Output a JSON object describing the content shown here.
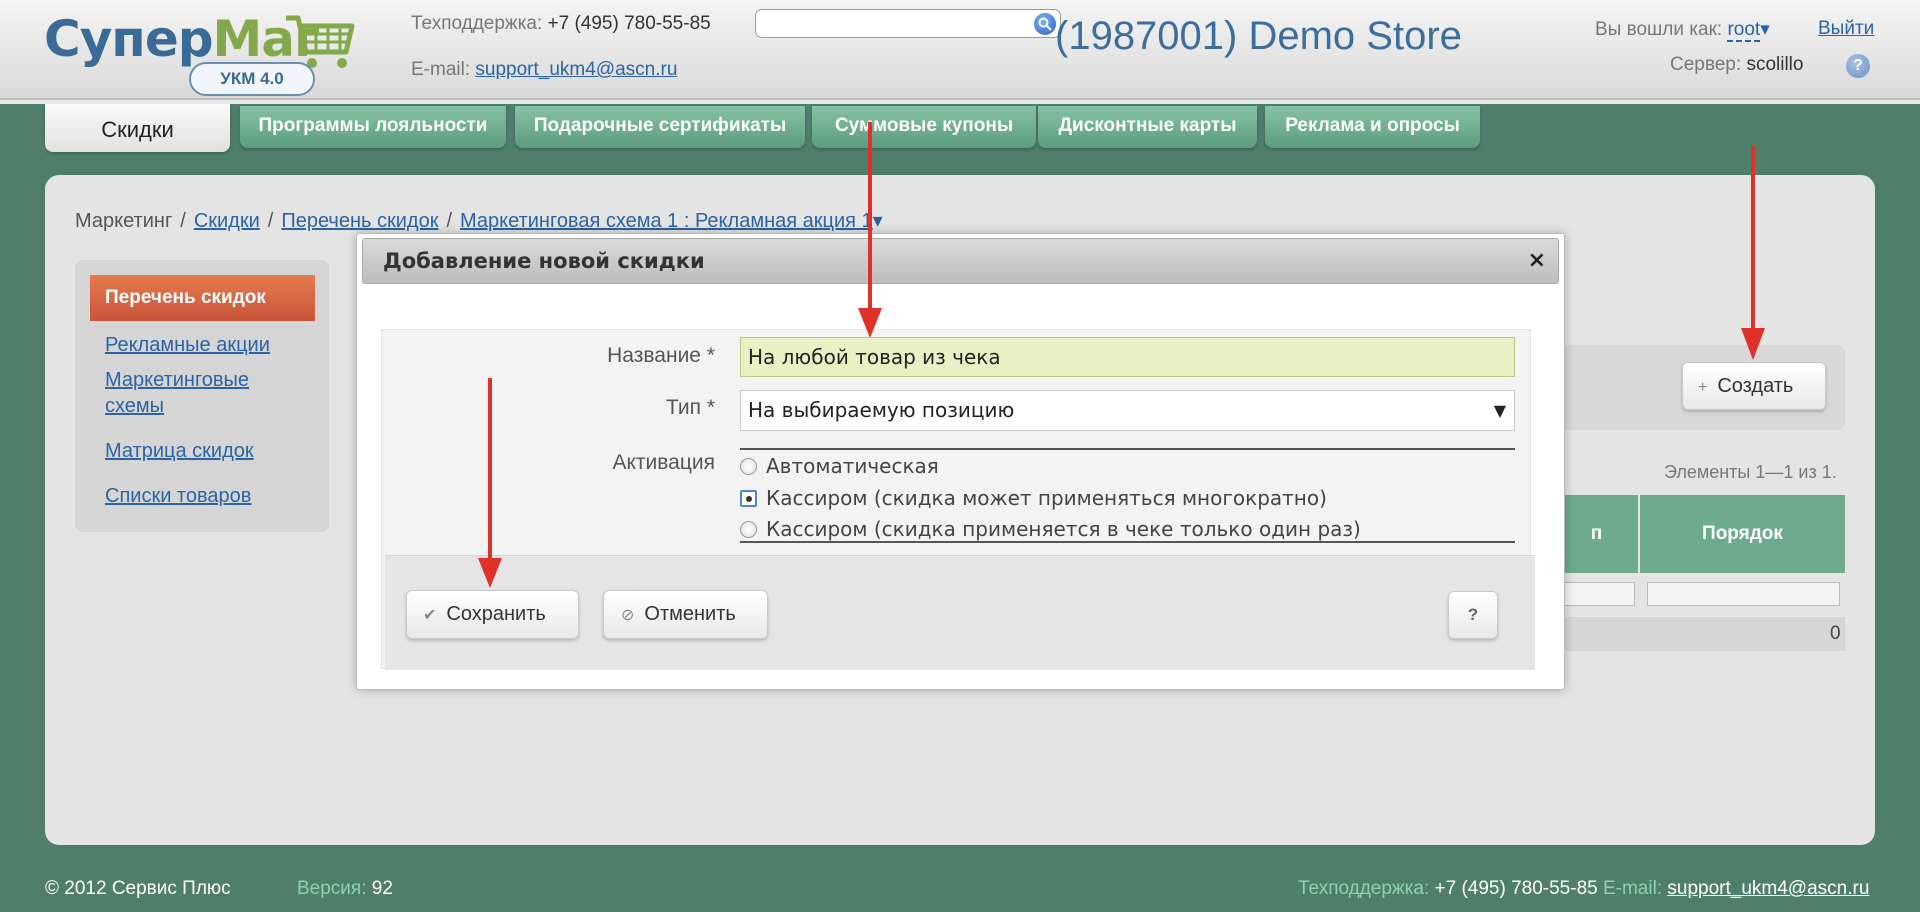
{
  "header": {
    "logo_primary": "Супер",
    "logo_secondary": "Маг",
    "logo_badge": "УКМ 4.0",
    "support_label": "Техподдержка:",
    "support_phone": "+7 (495) 780-55-85",
    "email_label": "E-mail:",
    "email": "support_ukm4@ascn.ru",
    "search_value": "",
    "store_title": "(1987001) Demo Store",
    "logged_in_label": "Вы вошли как:",
    "user": "root",
    "user_arrow": "▾",
    "logout": "Выйти",
    "server_label": "Сервер:",
    "server": "scolillo",
    "help": "?"
  },
  "tabs": [
    {
      "label": "Скидки",
      "active": true
    },
    {
      "label": "Программы лояльности"
    },
    {
      "label": "Подарочные сертификаты"
    },
    {
      "label": "Суммовые купоны"
    },
    {
      "label": "Дисконтные карты"
    },
    {
      "label": "Реклама и опросы"
    }
  ],
  "breadcrumb": {
    "root": "Маркетинг",
    "sep": "/",
    "items": [
      "Скидки",
      "Перечень скидок"
    ],
    "current": "Маркетинговая схема 1 : Рекламная акция 1",
    "current_arrow": "▾"
  },
  "sidebar": {
    "active": "Перечень скидок",
    "links": [
      "Рекламные акции",
      "Маркетинговые схемы",
      "Матрица скидок",
      "Списки товаров"
    ]
  },
  "toolbar": {
    "create_label": "Создать",
    "create_icon": "+"
  },
  "table": {
    "pager": "Элементы 1—1 из 1.",
    "headers": [
      "п",
      "Порядок"
    ],
    "row_order_value": "0"
  },
  "dialog": {
    "title": "Добавление новой скидки",
    "close": "×",
    "fields": {
      "name_label": "Название *",
      "name_value": "На любой товар из чека",
      "type_label": "Тип *",
      "type_value": "На выбираемую позицию",
      "type_arrow": "▼",
      "activation_label": "Активация",
      "activation_options": [
        {
          "label": "Автоматическая",
          "checked": false
        },
        {
          "label": "Кассиром (скидка может применяться многократно)",
          "checked": true
        },
        {
          "label": "Кассиром (скидка применяется в чеке только один раз)",
          "checked": false
        }
      ]
    },
    "buttons": {
      "save": "Сохранить",
      "cancel": "Отменить",
      "help": "?"
    }
  },
  "footer": {
    "copyright": "© 2012 Сервис Плюс",
    "version_label": "Версия:",
    "version": "92",
    "support_label": "Техподдержка:",
    "support_phone": "+7 (495) 780-55-85",
    "email_label": "E-mail:",
    "email": "support_ukm4@ascn.ru"
  },
  "colors": {
    "accent": "#2b63a6",
    "tab_green": "#6eaa8e",
    "annotation_arrow": "#e0302a",
    "active_menu": "#d8643f"
  }
}
